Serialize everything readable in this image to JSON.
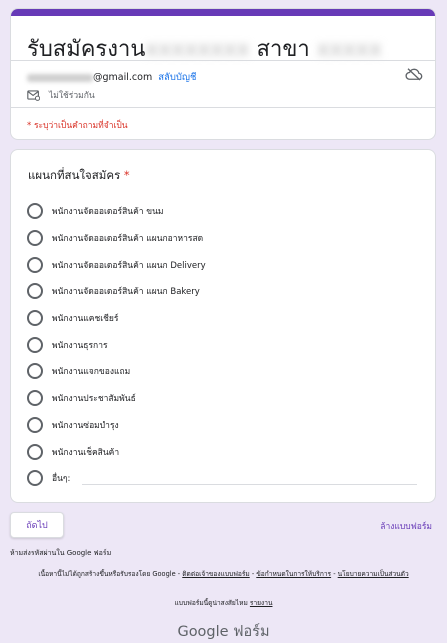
{
  "header": {
    "title_prefix": "รับสมัครงาน",
    "title_hidden_1": "xxxxxxxx",
    "title_mid": "สาขา",
    "title_hidden_2": "xxxxx",
    "account_email": "@gmail.com",
    "switch_account": "สลับบัญชี",
    "not_shared": "ไม่ใช้ร่วมกัน",
    "required_note": "* ระบุว่าเป็นคำถามที่จำเป็น"
  },
  "question": {
    "title": "แผนกที่สนใจสมัคร",
    "required_mark": "*",
    "options": [
      "พนักงานจัดออเดอร์สินค้า ขนม",
      "พนักงานจัดออเดอร์สินค้า แผนกอาหารสด",
      "พนักงานจัดออเดอร์สินค้า แผนก Delivery",
      "พนักงานจัดออเดอร์สินค้า แผนก Bakery",
      "พนักงานแคชเชียร์",
      "พนักงานธุรการ",
      "พนักงานแจกของแถม",
      "พนักงานประชาสัมพันธ์",
      "พนักงานซ่อมบำรุง",
      "พนักงานเช็คสินค้า"
    ],
    "other_label": "อื่นๆ:"
  },
  "footer": {
    "next": "ถัดไป",
    "clear": "ล้างแบบฟอร์ม",
    "never_submit": "ห้ามส่งรหัสผ่านใน Google ฟอร์ม",
    "disclaimer_text": "เนื้อหานี้ไม่ได้ถูกสร้างขึ้นหรือรับรองโดย Google -",
    "report_abuse": "ติดต่อเจ้าของแบบฟอร์ม",
    "terms": "ข้อกำหนดในการให้บริการ",
    "privacy": "นโยบายความเป็นส่วนตัว",
    "created_in": "แบบฟอร์มนี้ดูน่าสงสัยไหม",
    "report": "รายงาน",
    "brand_google": "Google",
    "brand_forms": "ฟอร์ม"
  },
  "colors": {
    "accent": "#673ab7",
    "background": "#ede7f6",
    "required": "#d93025",
    "link": "#1a73e8"
  }
}
